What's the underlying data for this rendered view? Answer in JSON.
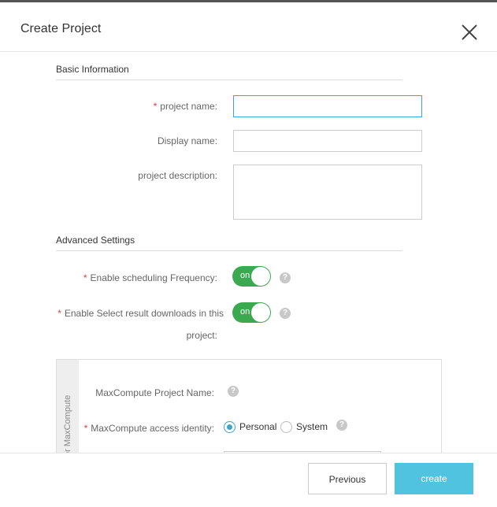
{
  "dialog": {
    "title": "Create Project",
    "close_icon": "close-icon"
  },
  "basic": {
    "section_title": "Basic Information",
    "project_name_label": "project name",
    "project_name_value": "",
    "display_name_label": "Display name",
    "display_name_value": "",
    "description_label": "project description",
    "description_value": "",
    "colon": ":"
  },
  "advanced": {
    "section_title": "Advanced Settings",
    "scheduling_label": "Enable scheduling Frequency",
    "scheduling_state": "on",
    "downloads_label_line1": "Enable Select result downloads in this",
    "downloads_label_line2": "project",
    "downloads_state": "on",
    "help_icon": "?"
  },
  "maxcompute": {
    "side_label": "or MaxCompute",
    "project_name_label": "MaxCompute Project Name:",
    "identity_label": "MaxCompute access identity:",
    "options": [
      "Personal",
      "System"
    ],
    "selected": "Personal"
  },
  "footer": {
    "previous_label": "Previous",
    "create_label": "create"
  },
  "colors": {
    "accent": "#3ea5c8",
    "switch_on": "#3aa94f",
    "create_button": "#4fc3e0",
    "required": "#e4393c"
  }
}
